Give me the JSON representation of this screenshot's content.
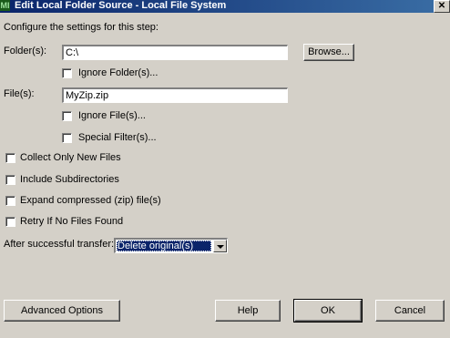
{
  "window": {
    "title": "Edit Local Folder Source - Local File System",
    "app_icon_text": "MI",
    "close_glyph": "✕"
  },
  "intro": "Configure the settings for this step:",
  "folder": {
    "label": "Folder(s):",
    "value": "C:\\",
    "browse_label": "Browse...",
    "ignore_label": "Ignore Folder(s)..."
  },
  "file": {
    "label": "File(s):",
    "value": "MyZip.zip",
    "ignore_label": "Ignore File(s)...",
    "special_filter_label": "Special Filter(s)..."
  },
  "options": {
    "collect_new": "Collect Only New Files",
    "include_subdirs": "Include Subdirectories",
    "expand_zip": "Expand compressed (zip) file(s)",
    "retry": "Retry If No Files Found"
  },
  "after_transfer": {
    "label": "After successful transfer:",
    "selected": "Delete original(s)"
  },
  "buttons": {
    "advanced": "Advanced Options",
    "help": "Help",
    "ok": "OK",
    "cancel": "Cancel"
  }
}
